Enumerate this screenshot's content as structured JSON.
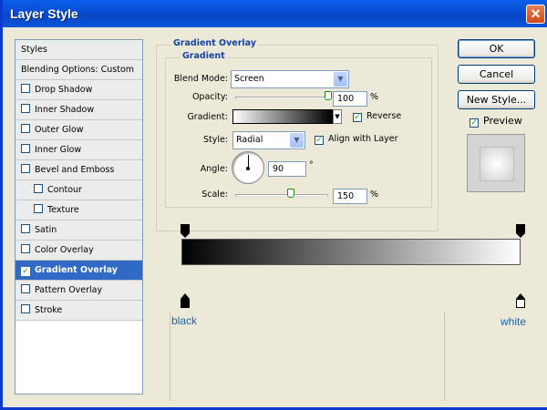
{
  "window": {
    "title": "Layer Style",
    "close_glyph": "✕"
  },
  "styles_panel": {
    "header": "Styles",
    "items": [
      {
        "label": "Blending Options: Custom",
        "checkbox": false,
        "checked": false,
        "indent": false,
        "selected": false
      },
      {
        "label": "Drop Shadow",
        "checkbox": true,
        "checked": false,
        "indent": false,
        "selected": false
      },
      {
        "label": "Inner Shadow",
        "checkbox": true,
        "checked": false,
        "indent": false,
        "selected": false
      },
      {
        "label": "Outer Glow",
        "checkbox": true,
        "checked": false,
        "indent": false,
        "selected": false
      },
      {
        "label": "Inner Glow",
        "checkbox": true,
        "checked": false,
        "indent": false,
        "selected": false
      },
      {
        "label": "Bevel and Emboss",
        "checkbox": true,
        "checked": false,
        "indent": false,
        "selected": false
      },
      {
        "label": "Contour",
        "checkbox": true,
        "checked": false,
        "indent": true,
        "selected": false
      },
      {
        "label": "Texture",
        "checkbox": true,
        "checked": false,
        "indent": true,
        "selected": false
      },
      {
        "label": "Satin",
        "checkbox": true,
        "checked": false,
        "indent": false,
        "selected": false
      },
      {
        "label": "Color Overlay",
        "checkbox": true,
        "checked": false,
        "indent": false,
        "selected": false
      },
      {
        "label": "Gradient Overlay",
        "checkbox": true,
        "checked": true,
        "indent": false,
        "selected": true
      },
      {
        "label": "Pattern Overlay",
        "checkbox": true,
        "checked": false,
        "indent": false,
        "selected": false
      },
      {
        "label": "Stroke",
        "checkbox": true,
        "checked": false,
        "indent": false,
        "selected": false
      }
    ]
  },
  "gradient_overlay": {
    "group_title": "Gradient Overlay",
    "subgroup_title": "Gradient",
    "blend_mode": {
      "label": "Blend Mode:",
      "value": "Screen"
    },
    "opacity": {
      "label": "Opacity:",
      "value": "100",
      "unit": "%",
      "level": 1.0
    },
    "gradient": {
      "label": "Gradient:",
      "reverse_label": "Reverse",
      "reverse_checked": true
    },
    "style": {
      "label": "Style:",
      "value": "Radial",
      "align_label": "Align with Layer",
      "align_checked": true
    },
    "angle": {
      "label": "Angle:",
      "value": "90",
      "unit": "°"
    },
    "scale": {
      "label": "Scale:",
      "value": "150",
      "unit": "%",
      "level": 0.6
    }
  },
  "buttons": {
    "ok": "OK",
    "cancel": "Cancel",
    "new_style": "New Style...",
    "preview_label": "Preview",
    "preview_checked": true
  },
  "gradient_editor": {
    "left_label": "black",
    "right_label": "white",
    "left_color": "#000000",
    "right_color": "#ffffff"
  },
  "colors": {
    "title_bar": "#0a4fd6",
    "selection": "#3169c6",
    "group_label": "#1444a8",
    "stop_label": "#1866b4"
  }
}
